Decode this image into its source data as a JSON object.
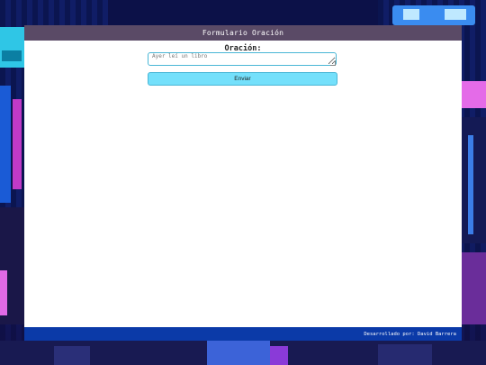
{
  "header": {
    "title": "Formulario Oración"
  },
  "form": {
    "label": "Oración:",
    "input_placeholder": "Ayer leí un libro",
    "submit_label": "Enviar"
  },
  "footer": {
    "credit": "Desarrollado por: David Barrera"
  },
  "colors": {
    "header_bg": "#5a4a66",
    "input_border": "#49b6d6",
    "button_bg": "#74e0fb",
    "footer_bg": "#0b3aa8"
  }
}
